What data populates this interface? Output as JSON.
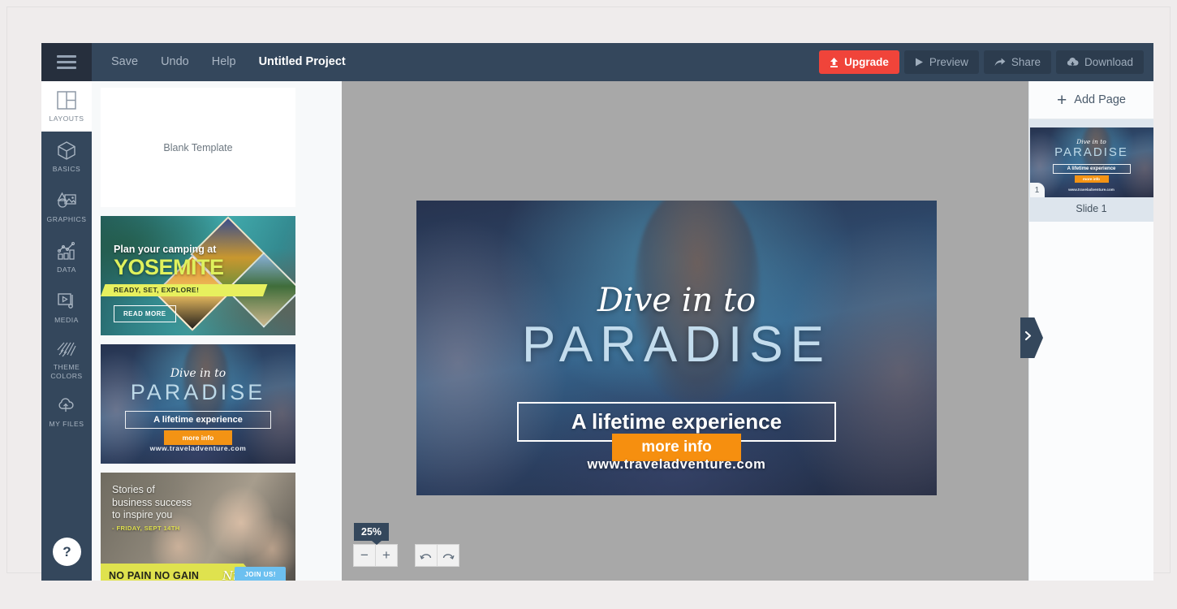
{
  "toolbar": {
    "menu_icon": "hamburger-icon",
    "items": [
      {
        "label": "Save",
        "name": "save"
      },
      {
        "label": "Undo",
        "name": "undo"
      },
      {
        "label": "Help",
        "name": "help"
      }
    ],
    "project_title": "Untitled Project",
    "actions": [
      {
        "label": "Upgrade",
        "icon": "upload-arrow-icon",
        "style": "primary",
        "color": "#f0443a"
      },
      {
        "label": "Preview",
        "icon": "play-icon",
        "style": "default"
      },
      {
        "label": "Share",
        "icon": "share-arrow-icon",
        "style": "default"
      },
      {
        "label": "Download",
        "icon": "cloud-download-icon",
        "style": "default"
      }
    ]
  },
  "sidebar": {
    "items": [
      {
        "label": "LAYOUTS",
        "icon": "layouts-icon",
        "active": true
      },
      {
        "label": "BASICS",
        "icon": "cube-icon",
        "active": false
      },
      {
        "label": "GRAPHICS",
        "icon": "graphics-icon",
        "active": false
      },
      {
        "label": "DATA",
        "icon": "chart-icon",
        "active": false
      },
      {
        "label": "MEDIA",
        "icon": "media-player-icon",
        "active": false
      },
      {
        "label": "THEME COLORS",
        "icon": "hatch-lines-icon",
        "active": false
      },
      {
        "label": "MY FILES",
        "icon": "cloud-upload-icon",
        "active": false
      }
    ],
    "help_label": "?"
  },
  "templates": {
    "blank_label": "Blank Template",
    "yosemite": {
      "line1": "Plan your camping at",
      "line2": "YOSEMITE",
      "band": "READY, SET, EXPLORE!",
      "button": "READ MORE"
    },
    "paradise": {
      "script": "Dive in to",
      "title": "PARADISE",
      "subtitle": "A lifetime experience",
      "cta": "more info",
      "url": "www.traveladventure.com"
    },
    "business": {
      "headline": "Stories of\nbusiness success\nto inspire you",
      "date": "- FRIDAY, SEPT 14TH",
      "band": "NO PAIN NO GAIN",
      "band_script": "Nights",
      "button": "JOIN US!"
    }
  },
  "canvas": {
    "banner": {
      "script": "Dive in to",
      "title": "PARADISE",
      "subtitle": "A lifetime experience",
      "cta": "more info",
      "url": "www.traveladventure.com",
      "cta_color": "#f68f0f"
    },
    "zoom_level": "25%",
    "zoom_out_label": "−",
    "zoom_in_label": "+",
    "undo_icon": "undo-arrow-icon",
    "redo_icon": "redo-arrow-icon",
    "collapse_icon": "chevron-right-icon"
  },
  "pages_panel": {
    "add_page_label": "Add Page",
    "add_page_icon": "plus-icon",
    "slides": [
      {
        "number": "1",
        "label": "Slide 1",
        "script": "Dive in to",
        "title": "PARADISE",
        "subtitle": "A lifetime experience",
        "cta": "more info",
        "url": "www.traveladventure.com",
        "selected": true
      }
    ]
  }
}
